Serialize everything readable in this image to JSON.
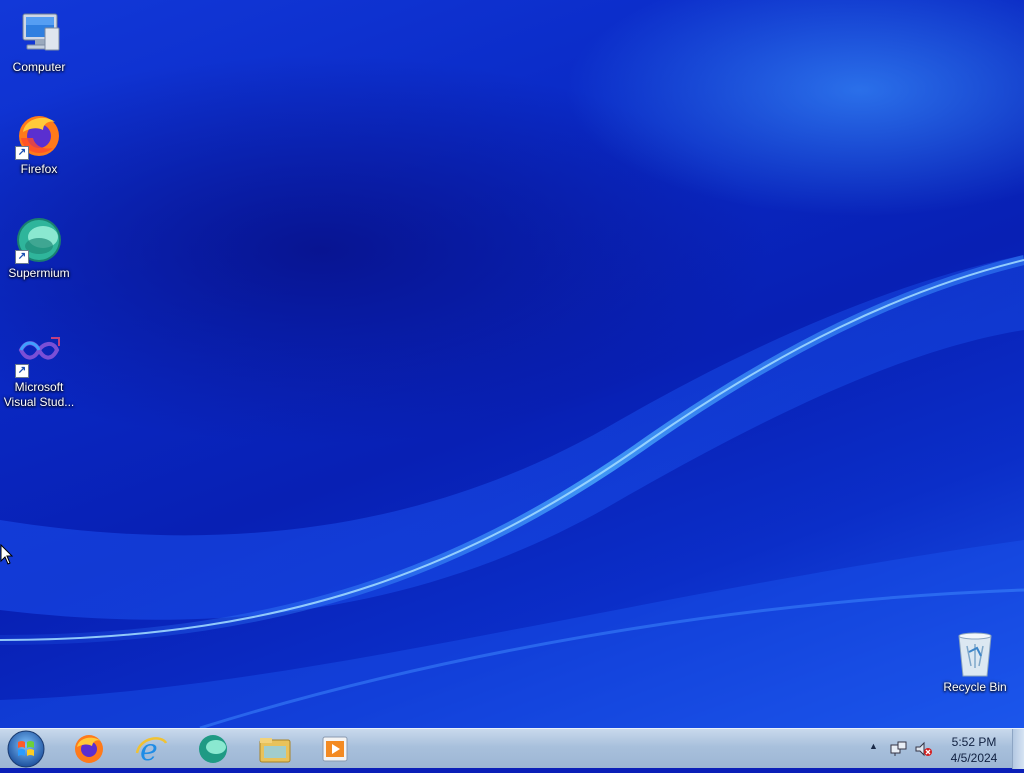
{
  "desktop": {
    "icons": [
      {
        "label": "Computer",
        "icon": "computer-icon",
        "shortcut": false
      },
      {
        "label": "Firefox",
        "icon": "firefox-icon",
        "shortcut": true
      },
      {
        "label": "Supermium",
        "icon": "supermium-icon",
        "shortcut": true
      },
      {
        "label_line1": "Microsoft",
        "label_line2": "Visual Stud...",
        "icon": "visual-studio-icon",
        "shortcut": true
      },
      {
        "label": "Recycle Bin",
        "icon": "recycle-bin-icon",
        "shortcut": false
      }
    ]
  },
  "taskbar": {
    "start": "start-orb-icon",
    "pinned": [
      {
        "app": "firefox-icon"
      },
      {
        "app": "internet-explorer-icon"
      },
      {
        "app": "supermium-icon"
      },
      {
        "app": "file-explorer-icon"
      },
      {
        "app": "media-player-icon"
      }
    ],
    "tray": {
      "overflow_arrow": "▲",
      "network": "network-icon",
      "volume": "volume-muted-icon"
    },
    "clock": {
      "time": "5:52 PM",
      "date": "4/5/2024"
    }
  },
  "colors": {
    "wallpaper_base": "#0b1fb8",
    "taskbar": "#a8c0dc",
    "icon_label": "#ffffff"
  }
}
